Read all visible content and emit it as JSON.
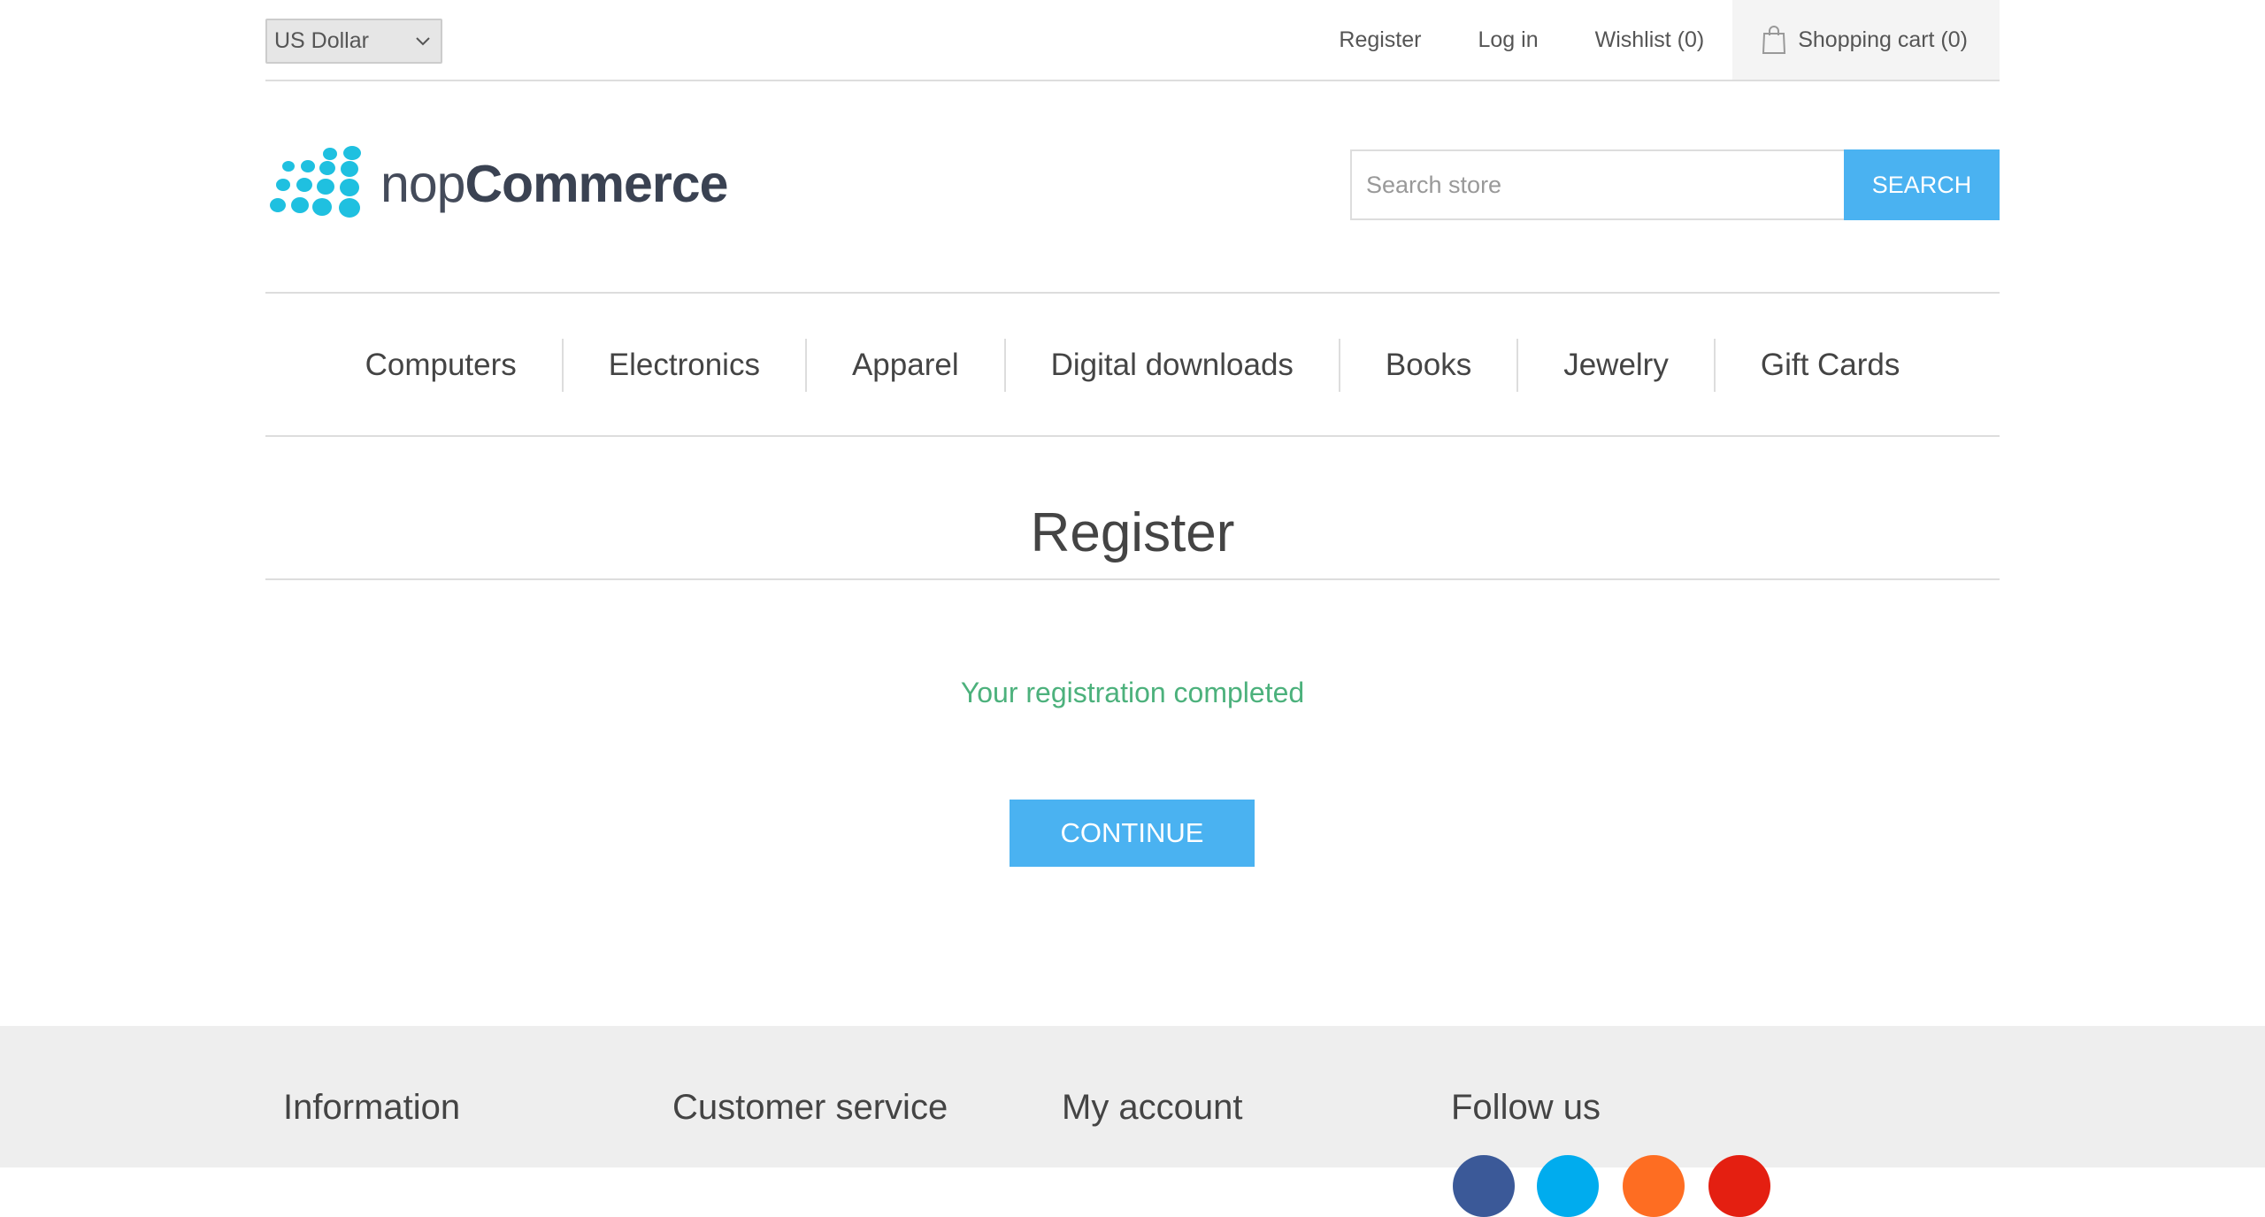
{
  "header": {
    "currency": "US Dollar",
    "links": {
      "register": "Register",
      "login": "Log in",
      "wishlist": "Wishlist (0)",
      "cart": "Shopping cart (0)"
    }
  },
  "logo": {
    "text_light": "nop",
    "text_bold": "Commerce",
    "color": "#1fc0e0"
  },
  "search": {
    "placeholder": "Search store",
    "button": "Search"
  },
  "menu": [
    "Computers",
    "Electronics",
    "Apparel",
    "Digital downloads",
    "Books",
    "Jewelry",
    "Gift Cards"
  ],
  "page": {
    "title": "Register",
    "result": "Your registration completed",
    "continue": "Continue"
  },
  "footer": {
    "columns": [
      "Information",
      "Customer service",
      "My account",
      "Follow us"
    ],
    "social": [
      "facebook-icon",
      "twitter-icon",
      "rss-icon",
      "youtube-icon"
    ]
  },
  "colors": {
    "accent": "#4ab2f1",
    "success": "#4cb17c",
    "border": "#dddddd",
    "footer_bg": "#eeeeee"
  }
}
